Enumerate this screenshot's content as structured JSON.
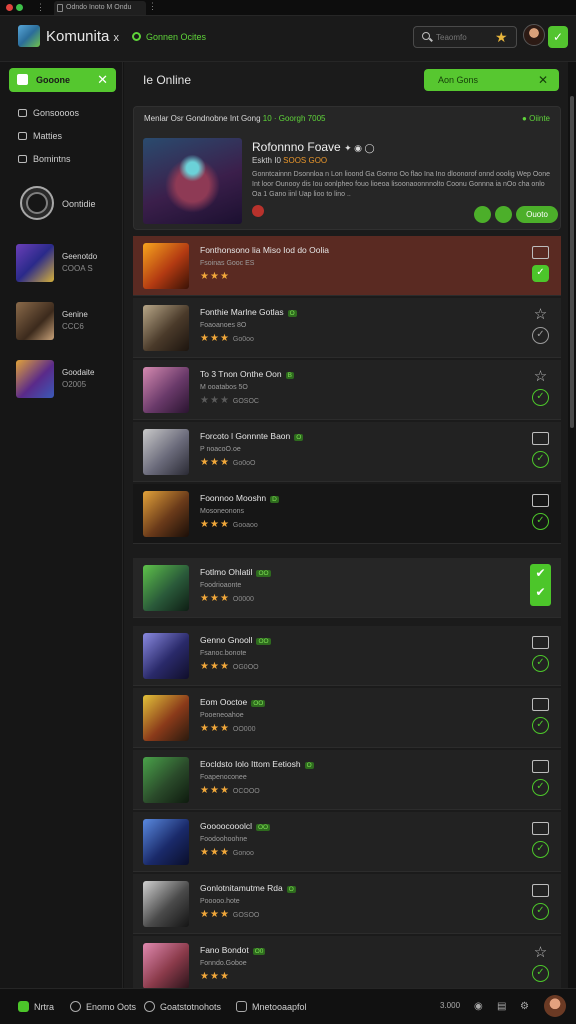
{
  "tab": {
    "title": "Odndo Inoto M Ondu"
  },
  "header": {
    "app_title": "Komunita",
    "close_glyph": "x",
    "status": "Gonnen Ocites",
    "search_placeholder": "Teaomfo"
  },
  "sidebar": {
    "home_label": "Gooone",
    "links": [
      "Gonsoooos",
      "Matties",
      "Bomintns"
    ],
    "emblem_label": "Oontidie",
    "games": [
      {
        "title": "Geenotdo",
        "sub": "COOA S"
      },
      {
        "title": "Genine",
        "sub": "CCC6"
      },
      {
        "title": "Goodaite",
        "sub": "O2005"
      }
    ]
  },
  "main": {
    "title": "Ie Online",
    "cta_label": "Aon Gons",
    "feature": {
      "head": "Menlar Osr Gondnobne Int Gong",
      "head_tag": "10 · Goorgh 7005",
      "online": "Oiinte",
      "title": "Rofonnno Foave",
      "sub": "Eskth I0",
      "sub_tag": "SOOS GOO",
      "desc": "Gonntcainnn Dsonnloa n Lon lioond Ga Gonno Oo flao Ina Ino dloonorof onnd ooolig Wep Oone Int loor Ounooy dis Iou oonlpheo fouo lioeoa lisoonaoonnnolto Coonu Gonnna ia nOo cha onlo Oa 1 Gano iinl Uap lioo to lino ..",
      "play_label": "Ouoto"
    },
    "rows": [
      {
        "title": "Fonthonsono lia Miso Iod do Oolia",
        "tag": "",
        "meta": "Fsoinas Gooc ES",
        "stars": 3,
        "count": ""
      },
      {
        "title": "Fonthie Marlne Gotlas",
        "tag": "O",
        "meta": "Foaoanoes 8O",
        "stars": 3,
        "count": "Go0oo"
      },
      {
        "title": "To 3 Tnon Onthe Oon",
        "tag": "B",
        "meta": "M ooatabos 5O",
        "stars": 0,
        "count": "GOSOC"
      },
      {
        "title": "Forcoto l Gonnnte Baon",
        "tag": "O",
        "meta": "P noacoO.oe",
        "stars": 3,
        "count": "Go0oO"
      },
      {
        "title": "Foonnoo Mooshn",
        "tag": "D",
        "meta": "Mosoneonons",
        "stars": 3,
        "count": "Gooaoo"
      },
      {
        "title": "Fotlmo Ohlatil",
        "tag": "OO",
        "meta": "Foodrioaonte",
        "stars": 3,
        "count": "O0000"
      },
      {
        "title": "Genno Gnooll",
        "tag": "OO",
        "meta": "Fsanoc.bonote",
        "stars": 3,
        "count": "OG0OO"
      },
      {
        "title": "Eom Ooctoe",
        "tag": "OO",
        "meta": "Pooeneoahoe",
        "stars": 3,
        "count": "OO000"
      },
      {
        "title": "Eocldsto Iolo Ittom Eetiosh",
        "tag": "O",
        "meta": "Foapenoconee",
        "stars": 3,
        "count": "OCOOO"
      },
      {
        "title": "Goooocooolcl",
        "tag": "OO",
        "meta": "Foodoohoohne",
        "stars": 3,
        "count": "Gonoo"
      },
      {
        "title": "Gonlotnitamutme Rda",
        "tag": "O",
        "meta": "Pooooo.hote",
        "stars": 3,
        "count": "GOSOO"
      },
      {
        "title": "Fano Bondot",
        "tag": "O0",
        "meta": "Fonndo.Goboe",
        "stars": 3,
        "count": ""
      }
    ]
  },
  "footer": {
    "items": [
      "Nrtra",
      "Enomo Oots",
      "Goatstotnohots",
      "Mnetooaapfol"
    ],
    "right_text": "3.000"
  },
  "colors": {
    "accent": "#55c72f",
    "highlight_row": "#5a2a22",
    "star": "#f0a73a",
    "background": "#141414"
  },
  "icons": [
    "search-icon",
    "trophy-icon",
    "home-icon",
    "close-icon",
    "check-icon",
    "bookmark-icon",
    "star-outline-icon",
    "gear-icon"
  ]
}
